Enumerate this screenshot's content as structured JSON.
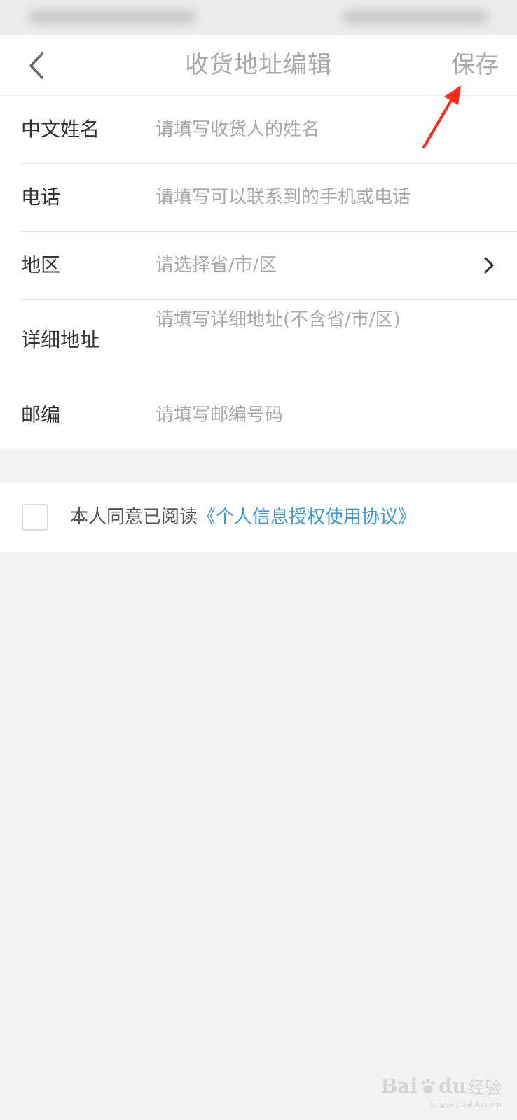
{
  "header": {
    "title": "收货地址编辑",
    "save_label": "保存"
  },
  "form": {
    "name": {
      "label": "中文姓名",
      "placeholder": "请填写收货人的姓名"
    },
    "phone": {
      "label": "电话",
      "placeholder": "请填写可以联系到的手机或电话"
    },
    "region": {
      "label": "地区",
      "placeholder": "请选择省/市/区"
    },
    "address": {
      "label": "详细地址",
      "placeholder": "请填写详细地址(不含省/市/区)"
    },
    "postcode": {
      "label": "邮编",
      "placeholder": "请填写邮编号码"
    }
  },
  "agreement": {
    "text": "本人同意已阅读",
    "link": "《个人信息授权使用协议》"
  },
  "watermark": {
    "brand_left": "Bai",
    "brand_right": "du",
    "brand_cn": "经验",
    "url": "jingyan.baidu.com"
  },
  "colors": {
    "link": "#3b9bd0",
    "annotation": "#ff2a1a",
    "placeholder": "#aaaaaa"
  }
}
